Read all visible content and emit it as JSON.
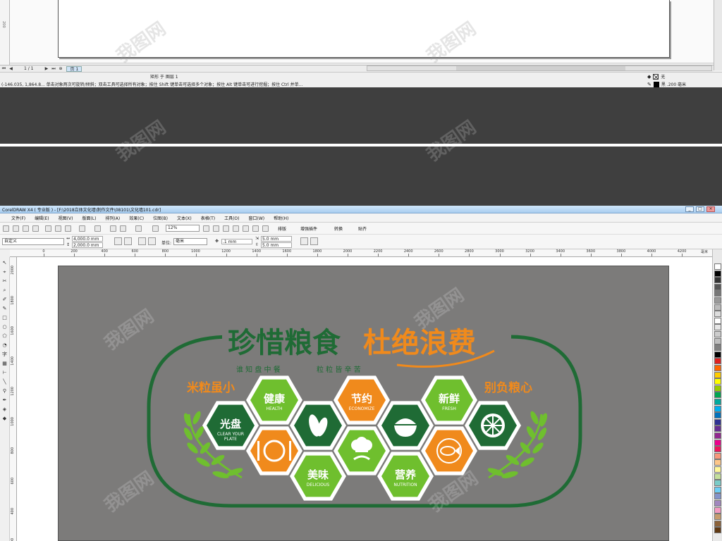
{
  "top_window": {
    "ruler_marks": [
      "200"
    ],
    "page_nav": {
      "counter": "1 / 1",
      "tab": "页 1"
    },
    "status_line1": "矩形 于 图层 1",
    "status_line2": "(-146.035, 1,864.8...    单击对象两次可旋转/倾斜；双击工具可选择所有对象；按住 Shift 键单击可选择多个对象；按住 Alt 键单击可进行挖掘；按住 Ctrl 并单...",
    "fill_label": "无",
    "outline_label": "黑 .200 毫米"
  },
  "window": {
    "title": "CorelDRAW X4 ( 专业版 ) - [F:\\2018立体文化墙\\制作文件\\08101\\文化墙101.cdr]",
    "controls": [
      "_",
      "□",
      "×"
    ]
  },
  "menu": [
    "文件(F)",
    "编辑(E)",
    "视图(V)",
    "版面(L)",
    "排列(A)",
    "效果(C)",
    "位图(B)",
    "文本(X)",
    "表格(T)",
    "工具(O)",
    "窗口(W)",
    "帮助(H)"
  ],
  "toolbar": {
    "zoom": "12%",
    "plugins": [
      "排版",
      "增强插件",
      "转换",
      "贴齐"
    ]
  },
  "property_bar": {
    "preset": "自定义",
    "width": "4,000.0 mm",
    "height": "2,000.0 mm",
    "unit_label": "单位:",
    "unit": "毫米",
    "nudge": ".1 mm",
    "dup_x": "5.0 mm",
    "dup_y": "5.0 mm"
  },
  "ruler": {
    "h_ticks": [
      "0",
      "200",
      "400",
      "600",
      "800",
      "1000",
      "1200",
      "1400",
      "1600",
      "1800",
      "2000",
      "2200",
      "2400",
      "2600",
      "2800",
      "3000",
      "3200",
      "3400",
      "3600",
      "3800",
      "4000",
      "4200"
    ],
    "h_unit": "毫米",
    "v_ticks": [
      "2000",
      "1800",
      "1600",
      "1400",
      "1200",
      "1000",
      "800",
      "600",
      "400",
      "200"
    ]
  },
  "design": {
    "title_green": "珍惜粮食",
    "title_orange": "杜绝浪费",
    "subtitle_left": "谁 知 盘 中 餐",
    "subtitle_right": "粒 粒 皆 辛 苦",
    "side_left": "米粒虽小",
    "side_right": "别负粮心",
    "hexes": [
      {
        "cn": "光盘",
        "en1": "CLEAR YOUR",
        "en2": "PLATE"
      },
      {
        "cn": "健康",
        "en1": "HEALTH",
        "en2": ""
      },
      {
        "cn": "节约",
        "en1": "ECONOMIZE",
        "en2": ""
      },
      {
        "cn": "新鲜",
        "en1": "FRESH",
        "en2": ""
      },
      {
        "cn": "美味",
        "en1": "DELICIOUS",
        "en2": ""
      },
      {
        "cn": "营养",
        "en1": "NUTRITION",
        "en2": ""
      }
    ],
    "icon_hexes": [
      "plate-fork-knife-icon",
      "leaf-icon",
      "chef-hat-icon",
      "rice-bowl-icon",
      "fish-icon",
      "lime-slice-icon"
    ]
  },
  "watermark": "我图网",
  "colors": {
    "green_dark": "#1f6b35",
    "green_light": "#6fbf2e",
    "orange": "#f08a1c",
    "board": "#7c7b7a"
  }
}
